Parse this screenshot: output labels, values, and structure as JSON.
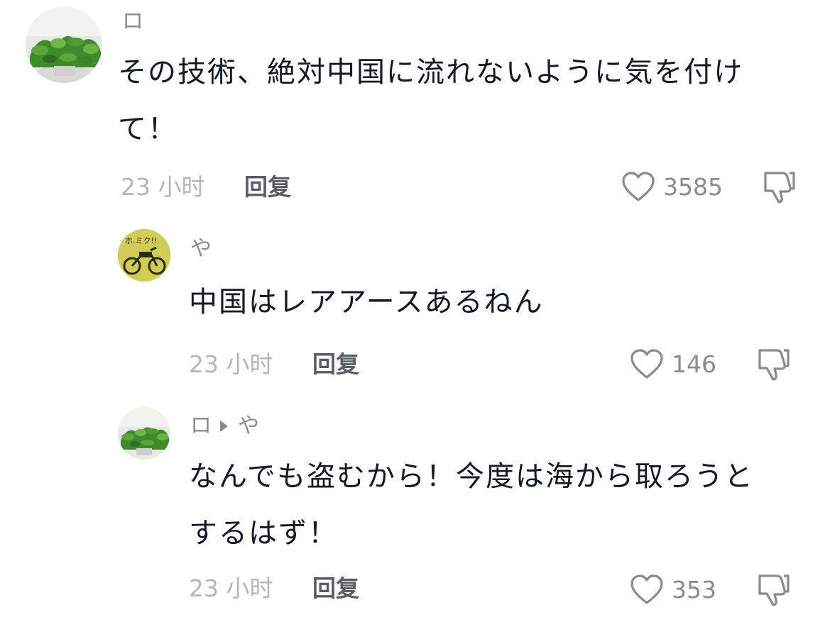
{
  "comments": [
    {
      "username": "ロ",
      "text": "その技術、絶対中国に流れないように気を付け\nて！",
      "time": "23 小时",
      "reply_label": "回复",
      "likes": "3585"
    },
    {
      "username": "や",
      "text": "中国はレアアースあるねん",
      "time": "23 小时",
      "reply_label": "回复",
      "likes": "146"
    },
    {
      "username": "ロ",
      "reply_to": "や",
      "text": "なんでも盗むから！今度は海から取ろうと\nするはず！",
      "time": "23 小时",
      "reply_label": "回复",
      "likes": "353"
    }
  ],
  "colors": {
    "text": "#161823",
    "meta": "#b4b5b9",
    "reply": "#5b5c63",
    "icon": "#8a8b91"
  }
}
